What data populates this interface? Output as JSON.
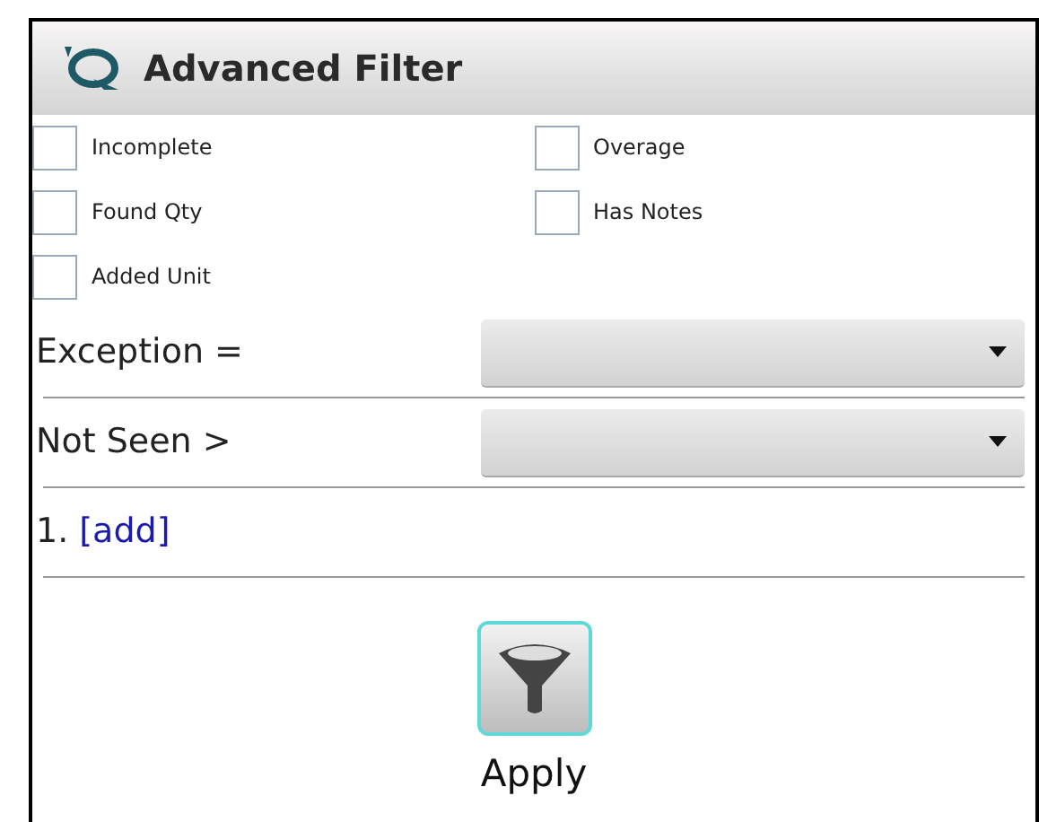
{
  "window": {
    "title": "Advanced Filter"
  },
  "checkboxes": [
    {
      "label": "Incomplete",
      "checked": false
    },
    {
      "label": "Overage",
      "checked": false
    },
    {
      "label": "Found Qty",
      "checked": false
    },
    {
      "label": "Has Notes",
      "checked": false
    },
    {
      "label": "Added Unit",
      "checked": false
    }
  ],
  "conditions": [
    {
      "label": "Exception ="
    },
    {
      "label": "Not Seen >"
    }
  ],
  "rules": [
    {
      "number": "1.",
      "link": "[add]"
    }
  ],
  "apply_button": {
    "label": "Apply"
  }
}
